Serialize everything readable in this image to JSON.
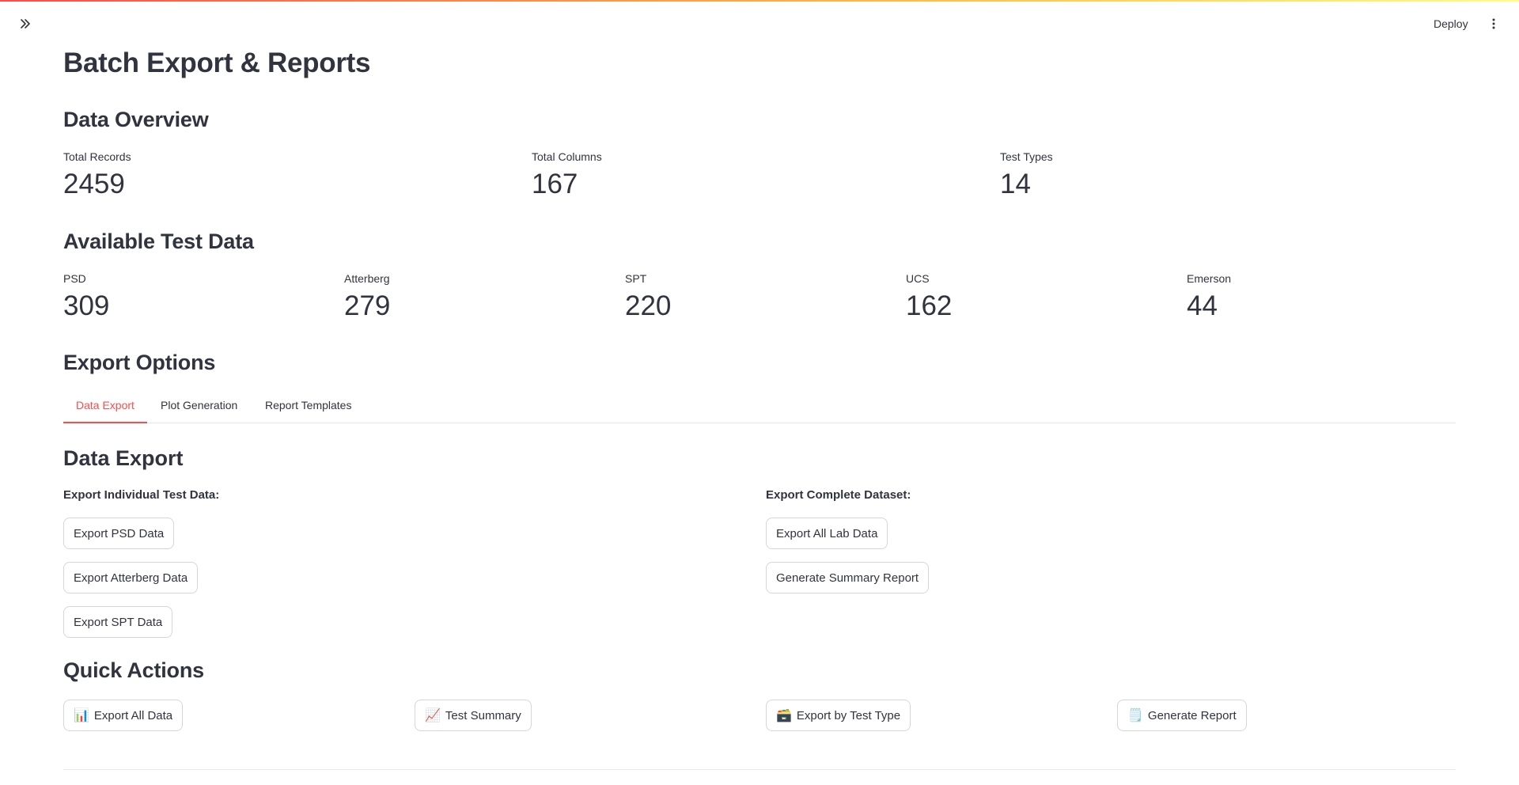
{
  "header": {
    "deploy_label": "Deploy",
    "sidebar_toggle_icon": "double-chevron-right-icon",
    "menu_icon": "kebab-menu-icon"
  },
  "page": {
    "title": "Batch Export & Reports"
  },
  "overview": {
    "heading": "Data Overview",
    "metrics": [
      {
        "label": "Total Records",
        "value": "2459"
      },
      {
        "label": "Total Columns",
        "value": "167"
      },
      {
        "label": "Test Types",
        "value": "14"
      }
    ]
  },
  "available": {
    "heading": "Available Test Data",
    "metrics": [
      {
        "label": "PSD",
        "value": "309"
      },
      {
        "label": "Atterberg",
        "value": "279"
      },
      {
        "label": "SPT",
        "value": "220"
      },
      {
        "label": "UCS",
        "value": "162"
      },
      {
        "label": "Emerson",
        "value": "44"
      }
    ]
  },
  "export_options": {
    "heading": "Export Options",
    "tabs": [
      {
        "label": "Data Export",
        "active": true
      },
      {
        "label": "Plot Generation",
        "active": false
      },
      {
        "label": "Report Templates",
        "active": false
      }
    ]
  },
  "data_export": {
    "heading": "Data Export",
    "individual_label": "Export Individual Test Data:",
    "individual_buttons": [
      "Export PSD Data",
      "Export Atterberg Data",
      "Export SPT Data"
    ],
    "complete_label": "Export Complete Dataset:",
    "complete_buttons": [
      "Export All Lab Data",
      "Generate Summary Report"
    ]
  },
  "quick_actions": {
    "heading": "Quick Actions",
    "buttons": [
      {
        "emoji": "📊",
        "label": "Export All Data",
        "icon": "bar-chart-icon"
      },
      {
        "emoji": "📈",
        "label": "Test Summary",
        "icon": "trending-up-chart-icon"
      },
      {
        "emoji": "🗃️",
        "label": "Export by Test Type",
        "icon": "card-file-box-icon"
      },
      {
        "emoji": "🗒️",
        "label": "Generate Report",
        "icon": "notepad-icon"
      }
    ]
  },
  "colors": {
    "accent": "#ff4b4b",
    "text": "#31333f",
    "border": "#d5d6da"
  }
}
